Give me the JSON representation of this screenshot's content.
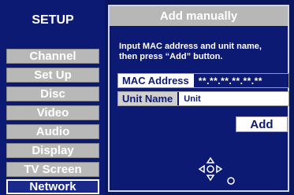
{
  "sidebar": {
    "title": "SETUP",
    "items": [
      {
        "label": "Channel"
      },
      {
        "label": "Set Up"
      },
      {
        "label": "Disc"
      },
      {
        "label": "Video"
      },
      {
        "label": "Audio"
      },
      {
        "label": "Display"
      },
      {
        "label": "TV Screen"
      },
      {
        "label": "Network",
        "active": true
      }
    ]
  },
  "panel": {
    "title": "Add manually",
    "instructions_line1": "Input MAC address and unit name,",
    "instructions_line2": "then press “Add” button.",
    "mac": {
      "label": "MAC Address",
      "value": "**.**.**.**.**.**"
    },
    "unit": {
      "label": "Unit Name",
      "value": "Unit"
    },
    "add_label": "Add"
  },
  "icons": {
    "nav": [
      "up-arrow-icon",
      "down-arrow-icon",
      "left-arrow-icon",
      "right-arrow-icon",
      "enter-button-icon",
      "return-icon"
    ]
  },
  "colors": {
    "background": "#0c1a73",
    "menu_inactive": "#b8b8b8",
    "header": "#b7b7b7",
    "text": "#ffffff"
  }
}
